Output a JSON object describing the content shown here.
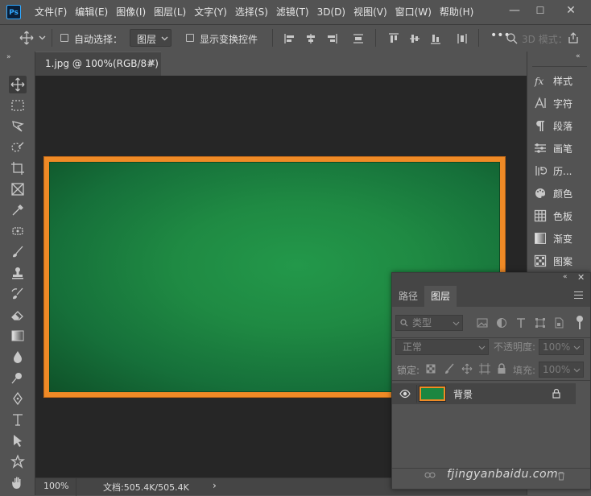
{
  "app": {
    "logo": "Ps"
  },
  "menu": [
    "文件(F)",
    "编辑(E)",
    "图像(I)",
    "图层(L)",
    "文字(Y)",
    "选择(S)",
    "滤镜(T)",
    "3D(D)",
    "视图(V)",
    "窗口(W)",
    "帮助(H)"
  ],
  "window_controls": {
    "minimize": "—",
    "maximize": "☐",
    "close": "✕"
  },
  "options_bar": {
    "auto_select_label": "自动选择：",
    "auto_select_value": "图层",
    "show_transform_label": "显示变换控件",
    "mode_3d_label": "3D 模式："
  },
  "document_tab": {
    "title": "1.jpg @ 100%(RGB/8#)",
    "close": "×"
  },
  "status_bar": {
    "zoom": "100%",
    "doc_info": "文档:505.4K/505.4K",
    "arrow": "›"
  },
  "right_panel": {
    "items": [
      {
        "icon": "fx-icon",
        "label": "样式"
      },
      {
        "icon": "character-icon",
        "label": "字符"
      },
      {
        "icon": "paragraph-icon",
        "label": "段落"
      },
      {
        "icon": "brush-settings-icon",
        "label": "画笔"
      },
      {
        "icon": "history-icon",
        "label": "历..."
      },
      {
        "icon": "color-palette-icon",
        "label": "颜色"
      },
      {
        "icon": "swatches-icon",
        "label": "色板"
      },
      {
        "icon": "gradient-icon",
        "label": "渐变"
      },
      {
        "icon": "pattern-icon",
        "label": "图案"
      }
    ]
  },
  "layers_panel": {
    "tabs": [
      "路径",
      "图层"
    ],
    "active_tab": "图层",
    "filter_label": "类型",
    "blend_mode": "正常",
    "opacity_label": "不透明度:",
    "opacity_value": "100%",
    "lock_label": "锁定:",
    "fill_label": "填充:",
    "fill_value": "100%",
    "layers": [
      {
        "name": "背景",
        "visible": true,
        "locked": true
      }
    ]
  },
  "watermark": "fjingyanbaidu.com",
  "colors": {
    "ui_bg": "#535353",
    "canvas_bg": "#262626",
    "board_frame": "#ef8a26",
    "board_green": "#1f8a43"
  }
}
